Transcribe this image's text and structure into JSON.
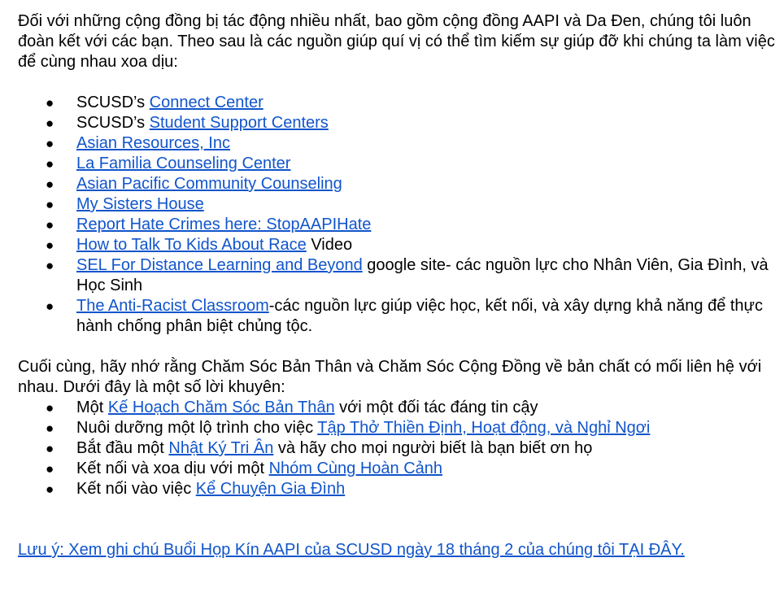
{
  "intro": {
    "line1": "Đối với những cộng đồng bị tác động nhiều nhất, bao gồm cộng đồng AAPI và Da Đen, chúng tôi luôn đoàn kết với các bạn.  Theo sau là các nguồn giúp quí vị có thể tìm kiếm sự giúp đỡ khi chúng ta làm việc để cùng nhau xoa dịu:"
  },
  "resources": [
    {
      "prefix": "SCUSD’s ",
      "link": " Connect Center",
      "suffix": ""
    },
    {
      "prefix": "SCUSD’s ",
      "link": "Student Support Centers",
      "suffix": ""
    },
    {
      "prefix": "",
      "link": "Asian Resources, Inc",
      "suffix": ""
    },
    {
      "prefix": "",
      "link": "La Familia Counseling Center",
      "suffix": ""
    },
    {
      "prefix": "",
      "link": "Asian Pacific Community Counseling",
      "suffix": ""
    },
    {
      "prefix": "",
      "link": "My Sisters House",
      "suffix": ""
    },
    {
      "prefix": "",
      "link": "Report Hate Crimes here: StopAAPIHate",
      "suffix": ""
    },
    {
      "prefix": "",
      "link": "How to Talk To Kids About Race",
      "suffix": " Video"
    },
    {
      "prefix": "",
      "link": "SEL For Distance Learning and Beyond",
      "suffix": " google site- các nguồn lực cho Nhân Viên, Gia Đình, và Học Sinh"
    },
    {
      "prefix": "",
      "link": "The Anti-Racist Classroom",
      "suffix": "-các nguồn lực giúp việc học, kết nối, và xây dựng khả năng để thực hành chống phân biệt chủng tộc."
    }
  ],
  "closing": {
    "text": "Cuối cùng, hãy nhớ rằng Chăm Sóc Bản Thân và Chăm Sóc Cộng Đồng về bản chất có mối liên hệ với nhau.  Dưới đây là một số lời khuyên:"
  },
  "tips": [
    {
      "prefix": "Một ",
      "link": "Kế Hoạch Chăm Sóc Bản Thân",
      "suffix": " với một đối tác đáng tin cậy"
    },
    {
      "prefix": "Nuôi dưỡng một lộ trình cho việc ",
      "link": "Tập Thở Thiền Định, Hoạt động, và Nghỉ Ngơi",
      "suffix": ""
    },
    {
      "prefix": "Bắt đầu một ",
      "link": "Nhật Ký Tri Ân",
      "suffix": " và hãy cho mọi người biết là bạn biết ơn họ"
    },
    {
      "prefix": "Kết nối và xoa dịu với một ",
      "link": "Nhóm Cùng Hoàn Cảnh",
      "suffix": ""
    },
    {
      "prefix": "Kết nối vào việc ",
      "link": "Kể Chuyện Gia Đình",
      "suffix": ""
    }
  ],
  "bullet_symbol": "●",
  "note_link": "Lưu ý: Xem ghi chú Buổi Họp Kín AAPI của SCUSD ngày 18 tháng 2 của chúng tôi TẠI ĐÂY.",
  "colors": {
    "link": "#1155cc",
    "text": "#000000",
    "background": "#ffffff"
  }
}
